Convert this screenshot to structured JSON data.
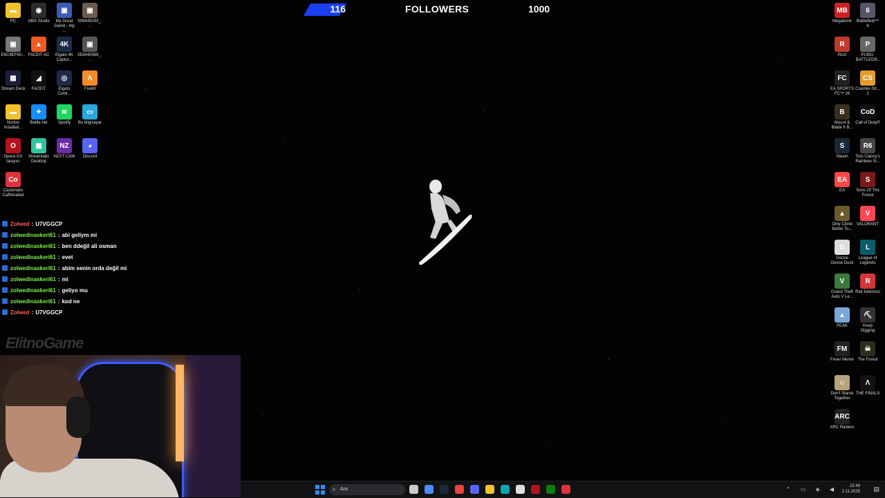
{
  "goal": {
    "current": "116",
    "title": "FOLLOWERS",
    "target": "1000",
    "progress_fraction": 0.116
  },
  "desktop_left": [
    {
      "label": "PC",
      "color": "#f2c12e",
      "glyph": "▬"
    },
    {
      "label": "OBS Studio",
      "color": "#2b2b2b",
      "glyph": "◉"
    },
    {
      "label": "My Great Game - My ...",
      "color": "#3b5bb5",
      "glyph": "▣"
    },
    {
      "label": "506845033_...",
      "color": "#6d5a4d",
      "glyph": "▣"
    },
    {
      "label": "E6C9EF65-...",
      "color": "#777",
      "glyph": "▣"
    },
    {
      "label": "FACEIT AC",
      "color": "#f05a23",
      "glyph": "▲"
    },
    {
      "label": "Elgato 4K Captur...",
      "color": "#1e2a4a",
      "glyph": "4K"
    },
    {
      "label": "553440565_...",
      "color": "#555",
      "glyph": "▣"
    },
    {
      "label": "Stream Deck",
      "color": "#1b1f3a",
      "glyph": "▦"
    },
    {
      "label": "FACEIT",
      "color": "#111",
      "glyph": "◢"
    },
    {
      "label": "Elgato Contr...",
      "color": "#1e2a4a",
      "glyph": "◎"
    },
    {
      "label": "FiveM",
      "color": "#f28c28",
      "glyph": "Λ"
    },
    {
      "label": "Norton Installati...",
      "color": "#f2c12e",
      "glyph": "▬"
    },
    {
      "label": "Battle.net",
      "color": "#148eff",
      "glyph": "✦"
    },
    {
      "label": "Spotify",
      "color": "#1ed760",
      "glyph": "≋"
    },
    {
      "label": "Bu bilgisayar",
      "color": "#29a8e0",
      "glyph": "▭"
    },
    {
      "label": "Opera GX tarayıcı",
      "color": "#b3121f",
      "glyph": "O"
    },
    {
      "label": "Streamlabs Desktop",
      "color": "#31c3a2",
      "glyph": "▣"
    },
    {
      "label": "NZXT CAM",
      "color": "#6a2ca8",
      "glyph": "NZ"
    },
    {
      "label": "Discord",
      "color": "#5865f2",
      "glyph": "◕"
    },
    {
      "label": "Casterlabs Caffeinated",
      "color": "#e0323c",
      "glyph": "Co"
    }
  ],
  "desktop_right": [
    {
      "label": "Megabonk",
      "color": "#c22",
      "glyph": "MB"
    },
    {
      "label": "Battlefield™ 6",
      "color": "#556",
      "glyph": "6"
    },
    {
      "label": "Rust",
      "color": "#c0392b",
      "glyph": "R"
    },
    {
      "label": "PUBG: BATTLEGR...",
      "color": "#666",
      "glyph": "P"
    },
    {
      "label": "EA SPORTS FC™ 26",
      "color": "#222",
      "glyph": "FC"
    },
    {
      "label": "Counter-Str... 2",
      "color": "#e39b2c",
      "glyph": "CS"
    },
    {
      "label": "Mount & Blade II B...",
      "color": "#3a2f1f",
      "glyph": "B"
    },
    {
      "label": "Call of Duty®",
      "color": "#111",
      "glyph": "CoD"
    },
    {
      "label": "Steam",
      "color": "#1b2838",
      "glyph": "S"
    },
    {
      "label": "Tom Clancy's Rainbow Si...",
      "color": "#444",
      "glyph": "R6"
    },
    {
      "label": "EA",
      "color": "#ff4747",
      "glyph": "EA"
    },
    {
      "label": "Sons Of The Forest",
      "color": "#7a1b1b",
      "glyph": "S"
    },
    {
      "label": "Only Climb Better To...",
      "color": "#6b5a2a",
      "glyph": "▲"
    },
    {
      "label": "VALORANT",
      "color": "#ff4655",
      "glyph": "V"
    },
    {
      "label": "Goose Goose Duck",
      "color": "#ddd",
      "glyph": "G"
    },
    {
      "label": "League of Legends",
      "color": "#0a5c6b",
      "glyph": "L"
    },
    {
      "label": "Grand Theft Auto V Le...",
      "color": "#3b7a3b",
      "glyph": "V"
    },
    {
      "label": "Riot İstemcisi",
      "color": "#d13639",
      "glyph": "R"
    },
    {
      "label": "PEAK",
      "color": "#7aa7d8",
      "glyph": "▲"
    },
    {
      "label": "Keep Digging",
      "color": "#333",
      "glyph": "⛏"
    },
    {
      "label": "Fever Meme",
      "color": "#222",
      "glyph": "FM"
    },
    {
      "label": "The Forest",
      "color": "#2d2d1d",
      "glyph": "☠"
    },
    {
      "label": "Don't Starve Together",
      "color": "#b8a27a",
      "glyph": "☺"
    },
    {
      "label": "THE FINALS",
      "color": "#111",
      "glyph": "Λ"
    },
    {
      "label": "ARC Raiders",
      "color": "#222",
      "glyph": "ARC"
    }
  ],
  "chat": [
    {
      "user": "Zolwed",
      "alt": true,
      "msg": "U7VGGCP"
    },
    {
      "user": "zolwedinaskeri61",
      "alt": false,
      "msg": "abi geliym mi"
    },
    {
      "user": "zolwedinaskeri61",
      "alt": false,
      "msg": "ben ddeğil ali osman"
    },
    {
      "user": "zolwedinaskeri61",
      "alt": false,
      "msg": "evet"
    },
    {
      "user": "zolwedinaskeri61",
      "alt": false,
      "msg": "abim senin orda değil mi"
    },
    {
      "user": "zolwedinaskeri61",
      "alt": false,
      "msg": "mi"
    },
    {
      "user": "zolwedinaskeri61",
      "alt": false,
      "msg": "geliyo mu"
    },
    {
      "user": "zolwedinaskeri61",
      "alt": false,
      "msg": "kod ne"
    },
    {
      "user": "Zolwed",
      "alt": true,
      "msg": "U7VGGCP"
    }
  ],
  "brand": "ElitnoGame",
  "taskbar": {
    "search_placeholder": "Ara",
    "time": "22:49",
    "date": "2.11.2025",
    "apps": [
      {
        "name": "file-explorer-taskbar",
        "color": "#c9c9c9"
      },
      {
        "name": "copilot-taskbar",
        "color": "#4b8cf5"
      },
      {
        "name": "steam-taskbar",
        "color": "#1b2838"
      },
      {
        "name": "chrome-taskbar",
        "color": "#e8453c"
      },
      {
        "name": "discord-taskbar",
        "color": "#5865f2"
      },
      {
        "name": "folder-taskbar",
        "color": "#f2c12e"
      },
      {
        "name": "edge-taskbar",
        "color": "#0fa3b1"
      },
      {
        "name": "store-taskbar",
        "color": "#ddd"
      },
      {
        "name": "opera-taskbar",
        "color": "#b3121f"
      },
      {
        "name": "xbox-taskbar",
        "color": "#107c10"
      },
      {
        "name": "app-taskbar",
        "color": "#e0323c"
      }
    ]
  }
}
